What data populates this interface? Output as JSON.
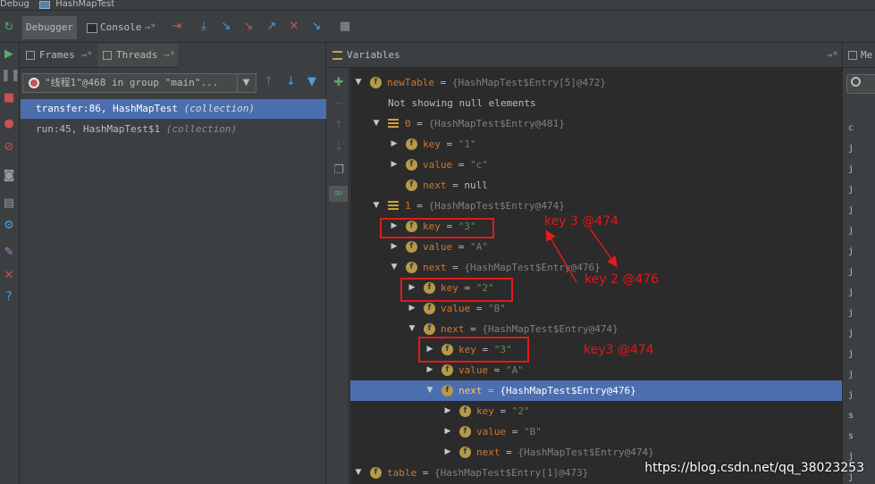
{
  "window": {
    "debug_label": "Debug",
    "run_config": "HashMapTest"
  },
  "toolstrip": {
    "tabs": [
      {
        "label": "Debugger"
      },
      {
        "label": "Console"
      }
    ],
    "buttons": [
      "resume-pin-icon",
      "show-execution-point-icon",
      "step-over-icon",
      "step-into-icon",
      "force-step-into-icon",
      "step-out-icon",
      "drop-frame-icon",
      "run-to-cursor-icon",
      "evaluate-icon"
    ]
  },
  "frames_panel": {
    "frames_tab": "Frames",
    "threads_tab": "Threads",
    "thread_selector": "\"线程1\"@468 in group \"main\"...",
    "frames": [
      {
        "method": "transfer:86, HashMapTest",
        "hint": "(collection)",
        "selected": true
      },
      {
        "method": "run:45, HashMapTest$1",
        "hint": "(collection)",
        "selected": false
      }
    ]
  },
  "variables_panel": {
    "title": "Variables",
    "rows": [
      {
        "name": "newTable",
        "eq": " = ",
        "value": "{HashMapTest$Entry[5]@472}",
        "kind": "obj"
      },
      {
        "text": "Not showing null elements"
      },
      {
        "name": "0",
        "eq": " = ",
        "value": "{HashMapTest$Entry@481}",
        "kind": "arr"
      },
      {
        "name": "key",
        "eq": " = ",
        "value": "\"1\"",
        "kind": "str"
      },
      {
        "name": "value",
        "eq": " = ",
        "value": "\"c\"",
        "kind": "str"
      },
      {
        "name": "next",
        "eq": " = ",
        "value": "null",
        "kind": "null"
      },
      {
        "name": "1",
        "eq": " = ",
        "value": "{HashMapTest$Entry@474}",
        "kind": "arr"
      },
      {
        "name": "key",
        "eq": " = ",
        "value": "\"3\"",
        "kind": "str"
      },
      {
        "name": "value",
        "eq": " = ",
        "value": "\"A\"",
        "kind": "str"
      },
      {
        "name": "next",
        "eq": " = ",
        "value": "{HashMapTest$Entry@476}",
        "kind": "obj"
      },
      {
        "name": "key",
        "eq": " = ",
        "value": "\"2\"",
        "kind": "str"
      },
      {
        "name": "value",
        "eq": " = ",
        "value": "\"B\"",
        "kind": "str"
      },
      {
        "name": "next",
        "eq": " = ",
        "value": "{HashMapTest$Entry@474}",
        "kind": "obj"
      },
      {
        "name": "key",
        "eq": " = ",
        "value": "\"3\"",
        "kind": "str"
      },
      {
        "name": "value",
        "eq": " = ",
        "value": "\"A\"",
        "kind": "str"
      },
      {
        "name": "next",
        "eq": " = ",
        "value": "{HashMapTest$Entry@476}",
        "kind": "obj",
        "selected": true
      },
      {
        "name": "key",
        "eq": " = ",
        "value": "\"2\"",
        "kind": "str"
      },
      {
        "name": "value",
        "eq": " = ",
        "value": "\"B\"",
        "kind": "str"
      },
      {
        "name": "next",
        "eq": " = ",
        "value": "{HashMapTest$Entry@474}",
        "kind": "obj"
      },
      {
        "name": "table",
        "eq": " = ",
        "value": "{HashMapTest$Entry[1]@473}",
        "kind": "obj"
      }
    ]
  },
  "right_panel": {
    "title": "Me",
    "rows": [
      "c",
      "j",
      "j",
      "j",
      "j",
      "j",
      "j",
      "j",
      "j",
      "j",
      "j",
      "j",
      "j",
      "j",
      "s",
      "s",
      "j",
      "j"
    ]
  },
  "annotations": {
    "label_1": "key 3  @474",
    "label_2": "key 2 @476",
    "label_3": "key3 @474"
  },
  "watermark": "https://blog.csdn.net/qq_38023253",
  "colors": {
    "background": "#2b2b2b",
    "panel": "#3c3f41",
    "selection": "#4b6eaf",
    "annotation_red": "#e01b1b"
  }
}
